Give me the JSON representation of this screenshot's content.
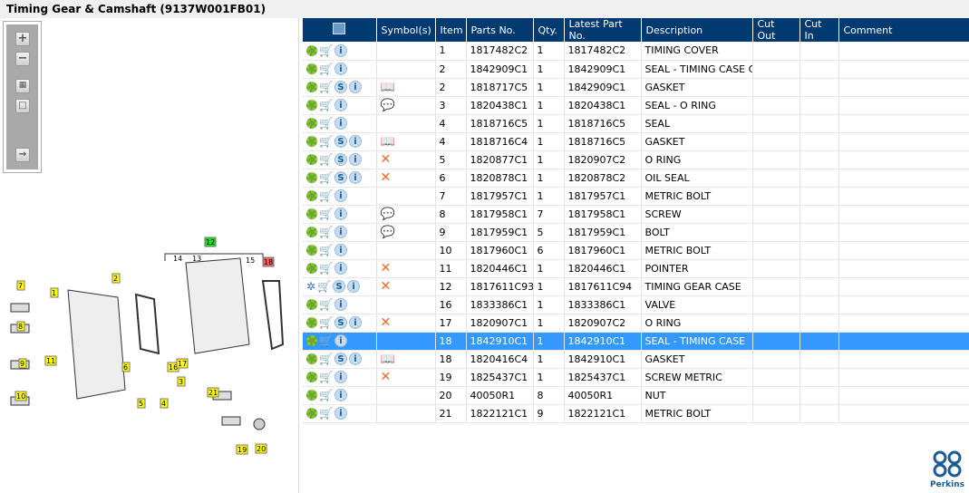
{
  "title": "Timing Gear & Camshaft (9137W001FB01)",
  "toolbar": {
    "zoom_in": "+",
    "zoom_out": "−"
  },
  "diagram": {
    "callouts": [
      "1",
      "2",
      "3",
      "4",
      "5",
      "6",
      "7",
      "8",
      "9",
      "10",
      "11",
      "12",
      "13",
      "14",
      "15",
      "16",
      "17",
      "18",
      "19",
      "20",
      "21"
    ]
  },
  "table": {
    "headers": [
      "",
      "Symbol(s)",
      "Item",
      "Parts No.",
      "Qty.",
      "Latest Part No.",
      "Description",
      "Cut Out",
      "Cut In",
      "Comment"
    ],
    "rows": [
      {
        "s": false,
        "sym": "",
        "item": "1",
        "part": "1817482C2",
        "qty": "1",
        "latest": "1817482C2",
        "desc": "TIMING COVER"
      },
      {
        "s": false,
        "sym": "",
        "item": "2",
        "part": "1842909C1",
        "qty": "1",
        "latest": "1842909C1",
        "desc": "SEAL - TIMING CASE CO"
      },
      {
        "s": true,
        "sym": "book",
        "item": "2",
        "part": "1818717C5",
        "qty": "1",
        "latest": "1842909C1",
        "desc": "GASKET"
      },
      {
        "s": false,
        "sym": "note",
        "item": "3",
        "part": "1820438C1",
        "qty": "1",
        "latest": "1820438C1",
        "desc": "SEAL - O RING"
      },
      {
        "s": false,
        "sym": "",
        "item": "4",
        "part": "1818716C5",
        "qty": "1",
        "latest": "1818716C5",
        "desc": "SEAL"
      },
      {
        "s": true,
        "sym": "book",
        "item": "4",
        "part": "1818716C4",
        "qty": "1",
        "latest": "1818716C5",
        "desc": "GASKET"
      },
      {
        "s": true,
        "sym": "x",
        "item": "5",
        "part": "1820877C1",
        "qty": "1",
        "latest": "1820907C2",
        "desc": "O RING"
      },
      {
        "s": true,
        "sym": "x",
        "item": "6",
        "part": "1820878C1",
        "qty": "1",
        "latest": "1820878C2",
        "desc": "OIL SEAL"
      },
      {
        "s": false,
        "sym": "",
        "item": "7",
        "part": "1817957C1",
        "qty": "1",
        "latest": "1817957C1",
        "desc": "METRIC BOLT"
      },
      {
        "s": false,
        "sym": "note",
        "item": "8",
        "part": "1817958C1",
        "qty": "7",
        "latest": "1817958C1",
        "desc": "SCREW"
      },
      {
        "s": false,
        "sym": "note",
        "item": "9",
        "part": "1817959C1",
        "qty": "5",
        "latest": "1817959C1",
        "desc": "BOLT"
      },
      {
        "s": false,
        "sym": "",
        "item": "10",
        "part": "1817960C1",
        "qty": "6",
        "latest": "1817960C1",
        "desc": "METRIC BOLT"
      },
      {
        "s": false,
        "sym": "x",
        "item": "11",
        "part": "1820446C1",
        "qty": "1",
        "latest": "1820446C1",
        "desc": "POINTER"
      },
      {
        "s": true,
        "sym": "x",
        "item": "12",
        "part": "1817611C93",
        "qty": "1",
        "latest": "1817611C94",
        "desc": "TIMING GEAR CASE",
        "multi": true
      },
      {
        "s": false,
        "sym": "",
        "item": "16",
        "part": "1833386C1",
        "qty": "1",
        "latest": "1833386C1",
        "desc": "VALVE"
      },
      {
        "s": true,
        "sym": "x",
        "item": "17",
        "part": "1820907C1",
        "qty": "1",
        "latest": "1820907C2",
        "desc": "O RING"
      },
      {
        "s": false,
        "sym": "",
        "item": "18",
        "part": "1842910C1",
        "qty": "1",
        "latest": "1842910C1",
        "desc": "SEAL - TIMING CASE",
        "selected": true
      },
      {
        "s": true,
        "sym": "book",
        "item": "18",
        "part": "1820416C4",
        "qty": "1",
        "latest": "1842910C1",
        "desc": "GASKET"
      },
      {
        "s": false,
        "sym": "x",
        "item": "19",
        "part": "1825437C1",
        "qty": "1",
        "latest": "1825437C1",
        "desc": "SCREW METRIC"
      },
      {
        "s": false,
        "sym": "",
        "item": "20",
        "part": "40050R1",
        "qty": "8",
        "latest": "40050R1",
        "desc": "NUT"
      },
      {
        "s": false,
        "sym": "",
        "item": "21",
        "part": "1822121C1",
        "qty": "9",
        "latest": "1822121C1",
        "desc": "METRIC BOLT"
      }
    ]
  },
  "logo": {
    "text": "Perkins"
  }
}
